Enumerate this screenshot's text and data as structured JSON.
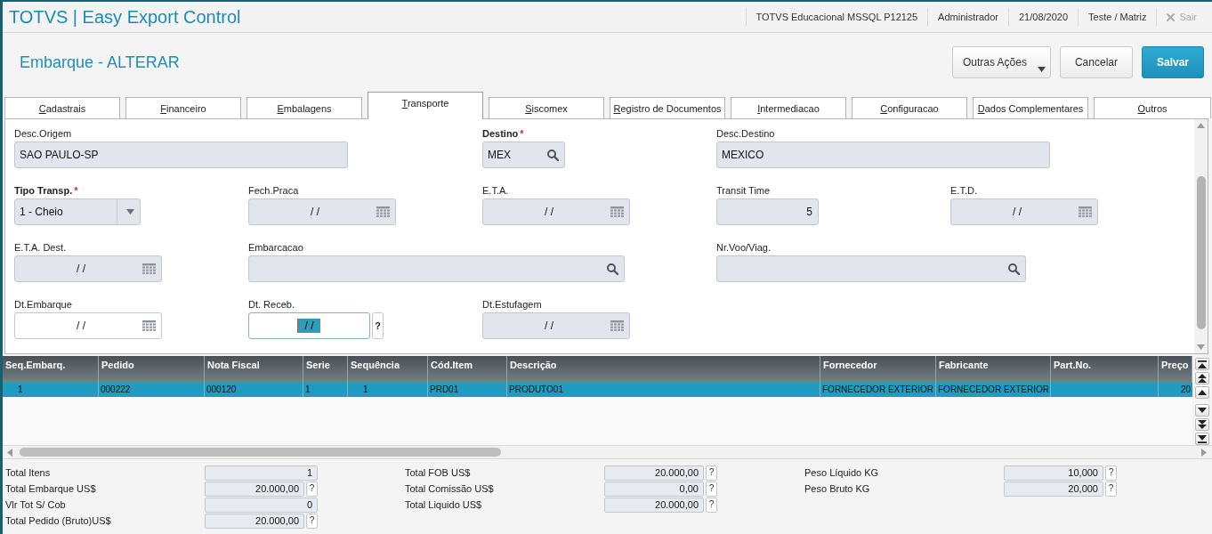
{
  "header": {
    "title": "TOTVS | Easy Export Control",
    "info": [
      "TOTVS Educacional MSSQL P12125",
      "Administrador",
      "21/08/2020",
      "Teste / Matriz"
    ],
    "exit": {
      "label": "Sair",
      "disabled": true
    }
  },
  "page": {
    "title": "Embarque - ALTERAR",
    "buttons": [
      {
        "label": "Outras Ações",
        "kind": "menu"
      },
      {
        "label": "Cancelar",
        "kind": "default"
      },
      {
        "label": "Salvar",
        "kind": "primary"
      }
    ]
  },
  "tabs": [
    {
      "label": "Cadastrais",
      "selected": false
    },
    {
      "label": "Financeiro",
      "selected": false
    },
    {
      "label": "Embalagens",
      "selected": false
    },
    {
      "label": "Transporte",
      "selected": true
    },
    {
      "label": "Siscomex",
      "selected": false
    },
    {
      "label": "Registro de Documentos",
      "selected": false
    },
    {
      "label": "Intermediacao",
      "selected": false
    },
    {
      "label": "Configuracao",
      "selected": false
    },
    {
      "label": "Dados Complementares",
      "selected": false
    },
    {
      "label": "Outros",
      "selected": false
    }
  ],
  "form": {
    "fields": [
      {
        "label": "Desc.Origem",
        "kind": "text",
        "value": "SAO PAULO-SP",
        "disabled": true,
        "focused": false
      },
      {
        "label": "Destino",
        "required_mark": "*",
        "kind": "search",
        "value": "MEX",
        "disabled": true,
        "focused": false
      },
      {
        "label": "Desc.Destino",
        "kind": "text",
        "value": "MEXICO",
        "disabled": true,
        "focused": false
      },
      {
        "label": "Tipo Transp.",
        "required_mark": "*",
        "kind": "select",
        "value": "1 - Cheio",
        "disabled": true,
        "focused": false
      },
      {
        "label": "Fech.Praca",
        "kind": "date",
        "value": "/ /",
        "disabled": true,
        "focused": false
      },
      {
        "label": "E.T.A.",
        "kind": "date",
        "value": "/ /",
        "disabled": true,
        "focused": false
      },
      {
        "label": "Transit Time",
        "kind": "number",
        "value": "5",
        "disabled": true,
        "focused": false
      },
      {
        "label": "E.T.D.",
        "kind": "date",
        "value": "/ /",
        "disabled": true,
        "focused": false
      },
      {
        "label": "E.T.A. Dest.",
        "kind": "date",
        "value": "/ /",
        "disabled": true,
        "focused": false
      },
      {
        "label": "Embarcacao",
        "kind": "search",
        "disabled": true,
        "focused": false
      },
      {
        "label": "Nr.Voo/Viag.",
        "kind": "search",
        "disabled": true,
        "focused": false
      },
      {
        "label": "Dt.Embarque",
        "kind": "date",
        "value": "/ /",
        "disabled": false,
        "focused": false
      },
      {
        "label": "Dt. Receb.",
        "kind": "entry",
        "value": "/ /",
        "disabled": false,
        "focused": true,
        "help": "?"
      },
      {
        "label": "Dt.Estufagem",
        "kind": "date",
        "value": "/ /",
        "disabled": true,
        "focused": false
      }
    ]
  },
  "table": {
    "columns": [
      "Seq.Embarq.",
      "Pedido",
      "Nota Fiscal",
      "Serie",
      "Sequência",
      "Cód.Item",
      "Descrição",
      "Fornecedor",
      "Fabricante",
      "Part.No.",
      "Preço"
    ],
    "rows": [
      {
        "selected": true,
        "cells": [
          "1",
          "000222",
          "000120",
          "1",
          "1",
          "PRD01",
          "PRODUTO01",
          "FORNECEDOR EXTERIOR",
          "FORNECEDOR EXTERIOR",
          null,
          "20"
        ]
      }
    ]
  },
  "totals": {
    "groups": [
      [
        {
          "label": "Total Itens",
          "value": "1"
        },
        {
          "label": "Total Embarque US$",
          "value": "20.000,00",
          "help": "?"
        },
        {
          "label": "Vlr Tot S/ Cob",
          "value": "0"
        },
        {
          "label": "Total Pedido (Bruto)US$",
          "value": "20.000,00",
          "help": "?"
        }
      ],
      [
        {
          "label": "Total FOB US$",
          "value": "20.000,00",
          "help": "?"
        },
        {
          "label": "Total Comissão US$",
          "value": "0,00",
          "help": "?"
        },
        {
          "label": "Total Liquido US$",
          "value": "20.000,00",
          "help": "?"
        }
      ],
      [
        {
          "label": "Peso Líquido KG",
          "value": "10,000",
          "help": "?"
        },
        {
          "label": "Peso Bruto KG",
          "value": "20,000",
          "help": "?"
        }
      ]
    ]
  }
}
